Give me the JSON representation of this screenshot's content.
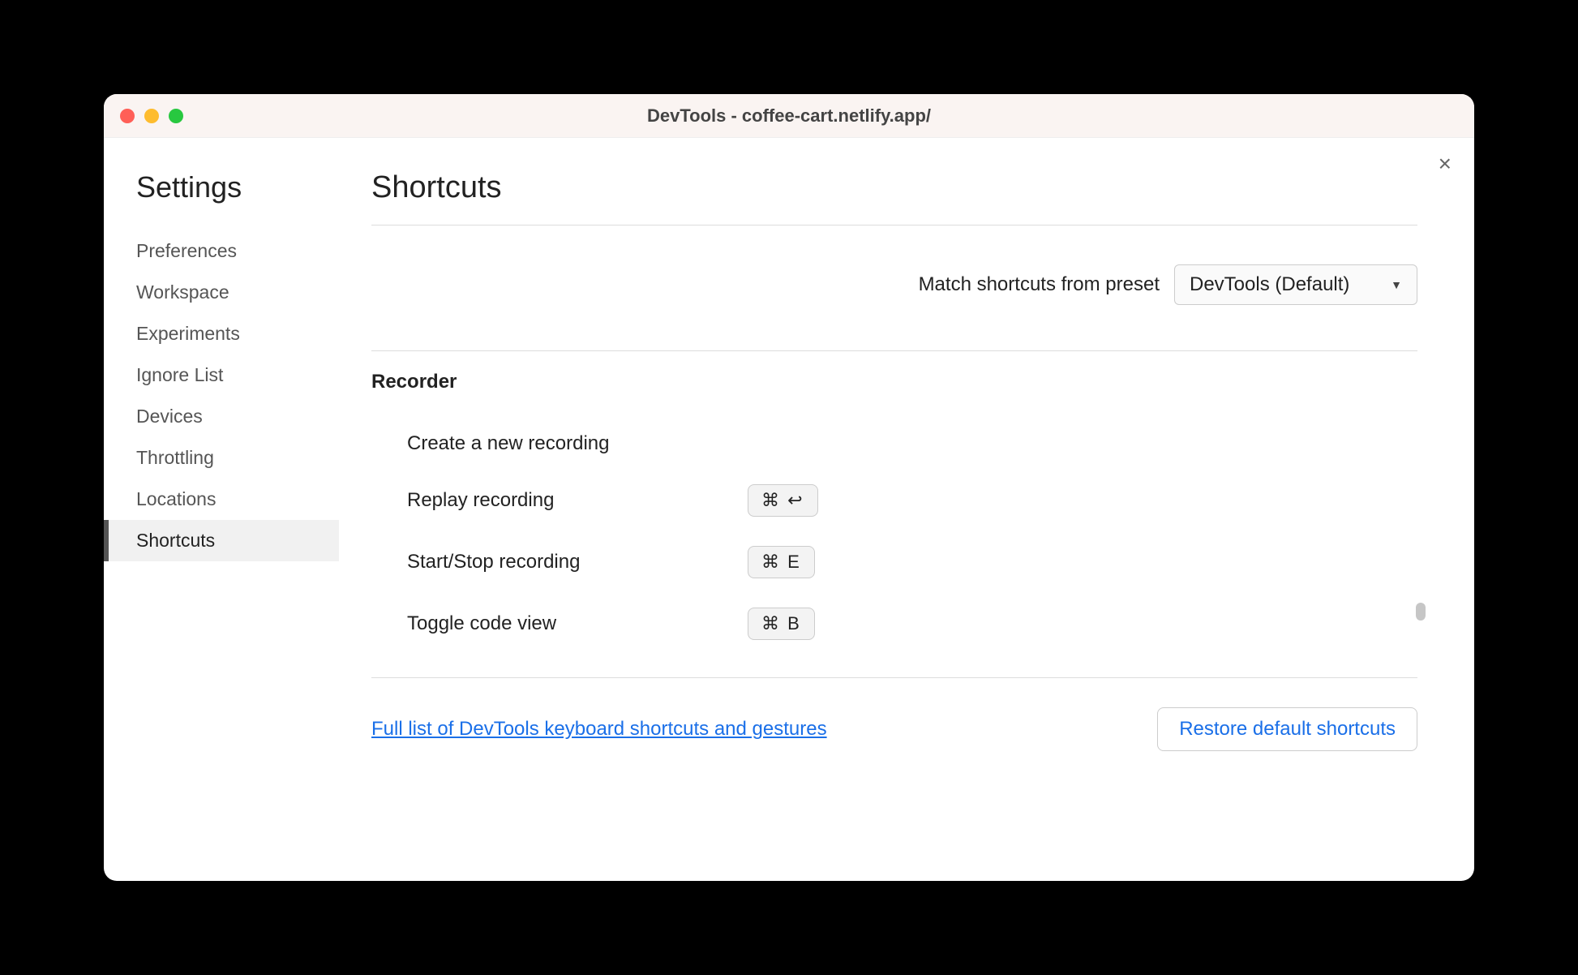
{
  "window": {
    "title": "DevTools - coffee-cart.netlify.app/"
  },
  "sidebar": {
    "title": "Settings",
    "items": [
      {
        "label": "Preferences",
        "active": false
      },
      {
        "label": "Workspace",
        "active": false
      },
      {
        "label": "Experiments",
        "active": false
      },
      {
        "label": "Ignore List",
        "active": false
      },
      {
        "label": "Devices",
        "active": false
      },
      {
        "label": "Throttling",
        "active": false
      },
      {
        "label": "Locations",
        "active": false
      },
      {
        "label": "Shortcuts",
        "active": true
      }
    ]
  },
  "main": {
    "page_title": "Shortcuts",
    "close_label": "×",
    "preset_label": "Match shortcuts from preset",
    "preset_value": "DevTools (Default)",
    "section": {
      "title": "Recorder",
      "rows": [
        {
          "label": "Create a new recording",
          "keys": ""
        },
        {
          "label": "Replay recording",
          "keys": "⌘ ↩"
        },
        {
          "label": "Start/Stop recording",
          "keys": "⌘ E"
        },
        {
          "label": "Toggle code view",
          "keys": "⌘ B"
        }
      ]
    },
    "full_list_link": "Full list of DevTools keyboard shortcuts and gestures",
    "restore_button": "Restore default shortcuts"
  }
}
